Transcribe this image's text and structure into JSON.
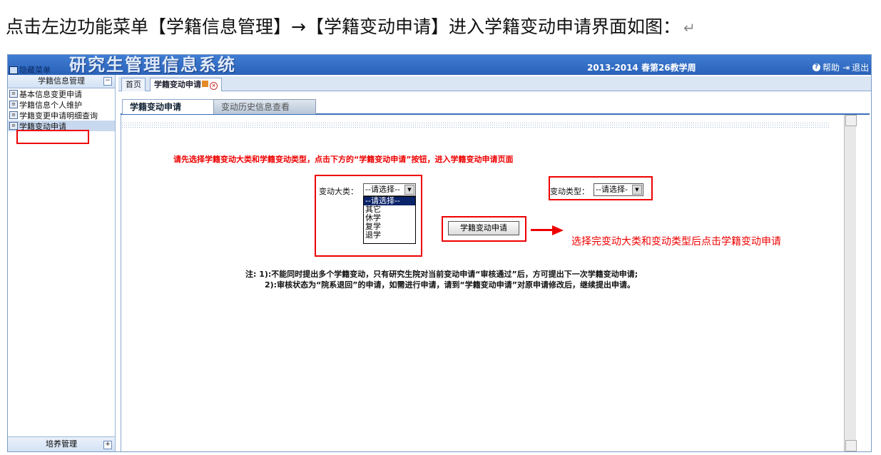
{
  "doc": {
    "instruction": "点击左边功能菜单【学籍信息管理】→【学籍变动申请】进入学籍变动申请界面如图：",
    "para_mark": "↵"
  },
  "banner": {
    "hide_menu": "隐藏菜单",
    "system_title": "研究生管理信息系统",
    "semester": "2013-2014 春第26教学周",
    "help": "帮助",
    "exit": "退出"
  },
  "sidebar": {
    "section_title": "学籍信息管理",
    "collapse_symbol": "−",
    "items": [
      {
        "label": "基本信息变更申请"
      },
      {
        "label": "学籍信息个人维护"
      },
      {
        "label": "学籍变更申请明细查询"
      },
      {
        "label": "学籍变动申请"
      }
    ],
    "bottom_section": "培养管理",
    "expand_symbol": "+"
  },
  "tabs": {
    "home": "首页",
    "current": "学籍变动申请"
  },
  "subtabs": {
    "apply": "学籍变动申请",
    "history": "变动历史信息查看"
  },
  "form": {
    "instruction": "请先选择学籍变动大类和学籍变动类型，点击下方的“学籍变动申请”按钮，进入学籍变动申请页面",
    "category_label": "变动大类：",
    "category_value": "--请选择--",
    "category_options": [
      "--请选择--",
      "其它",
      "休学",
      "复学",
      "退学"
    ],
    "type_label": "变动类型：",
    "type_value": "--请选择-",
    "submit_button": "学籍变动申请"
  },
  "annotation": "选择完变动大类和变动类型后点击学籍变动申请",
  "notes": {
    "line1": "注: 1):不能同时提出多个学籍变动，只有研究生院对当前变动申请“审核通过”后，方可提出下一次学籍变动申请;",
    "line2": "2):审核状态为“院系退回”的申请，如需进行申请，请到“学籍变动申请”对原申请修改后，继续提出申请。"
  },
  "colors": {
    "highlight": "#ee0000",
    "banner": "#2a62b8"
  }
}
